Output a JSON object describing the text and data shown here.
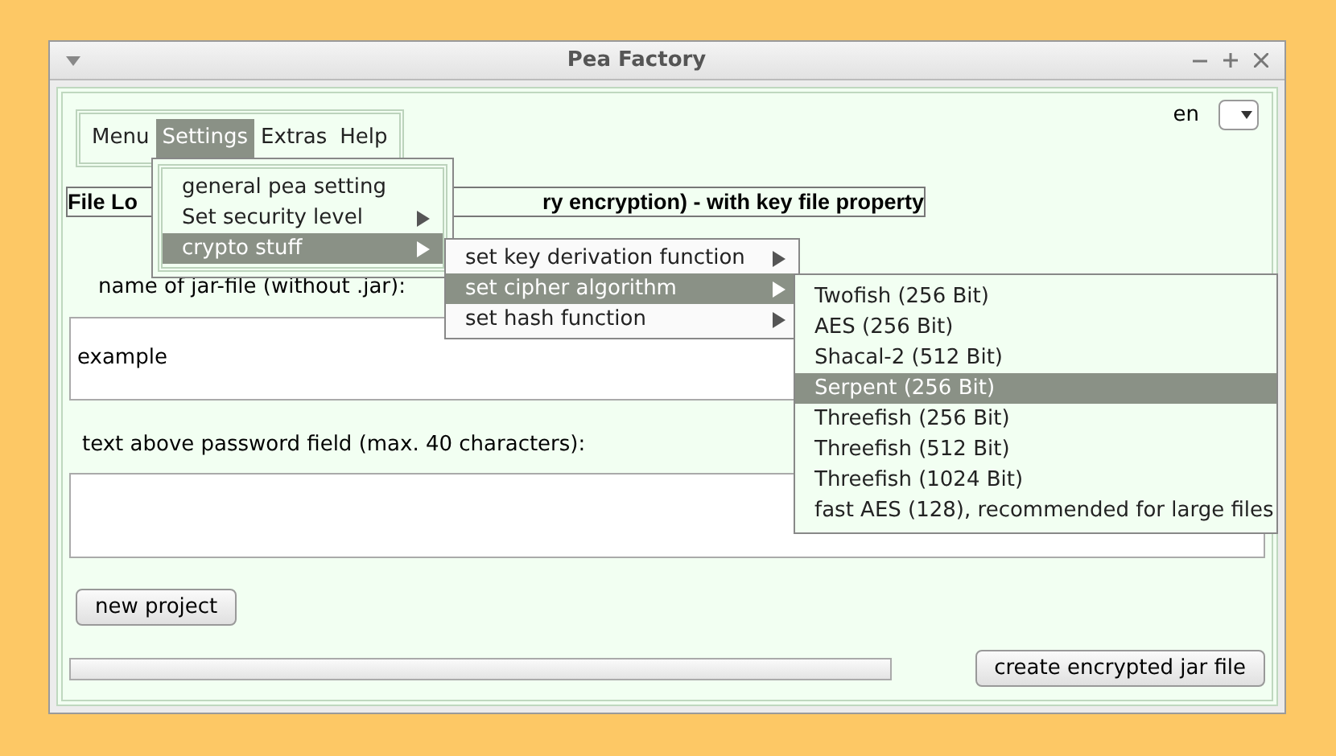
{
  "window": {
    "title": "Pea Factory"
  },
  "menubar": [
    {
      "label": "Menu",
      "selected": false
    },
    {
      "label": "Settings",
      "selected": true
    },
    {
      "label": "Extras",
      "selected": false
    },
    {
      "label": "Help",
      "selected": false
    }
  ],
  "language": {
    "value": "en"
  },
  "header": {
    "left": "File Lo",
    "right": "ry encryption) - with key file property"
  },
  "jar_name": {
    "label": "name of jar-file (without .jar):",
    "value": "example"
  },
  "password_text": {
    "label": "text above password field (max. 40 characters):"
  },
  "buttons": {
    "new_project": "new project",
    "create": "create encrypted jar file"
  },
  "progress": {
    "level": 0
  },
  "settings_menu": [
    {
      "label": "general pea setting",
      "submenu": false,
      "selected": false
    },
    {
      "label": "Set security level",
      "submenu": true,
      "selected": false
    },
    {
      "label": "crypto stuff",
      "submenu": true,
      "selected": true
    }
  ],
  "crypto_menu": [
    {
      "label": "set key derivation function",
      "submenu": true,
      "selected": false
    },
    {
      "label": "set cipher algorithm",
      "submenu": true,
      "selected": true
    },
    {
      "label": "set hash function",
      "submenu": true,
      "selected": false
    }
  ],
  "cipher_menu": [
    {
      "label": "Twofish (256 Bit)",
      "selected": false
    },
    {
      "label": "AES (256 Bit)",
      "selected": false
    },
    {
      "label": "Shacal-2 (512 Bit)",
      "selected": false
    },
    {
      "label": "Serpent (256 Bit)",
      "selected": true
    },
    {
      "label": "Threefish (256 Bit)",
      "selected": false
    },
    {
      "label": "Threefish (512 Bit)",
      "selected": false
    },
    {
      "label": "Threefish (1024 Bit)",
      "selected": false
    },
    {
      "label": "fast AES (128), recommended for large files",
      "selected": false
    }
  ]
}
